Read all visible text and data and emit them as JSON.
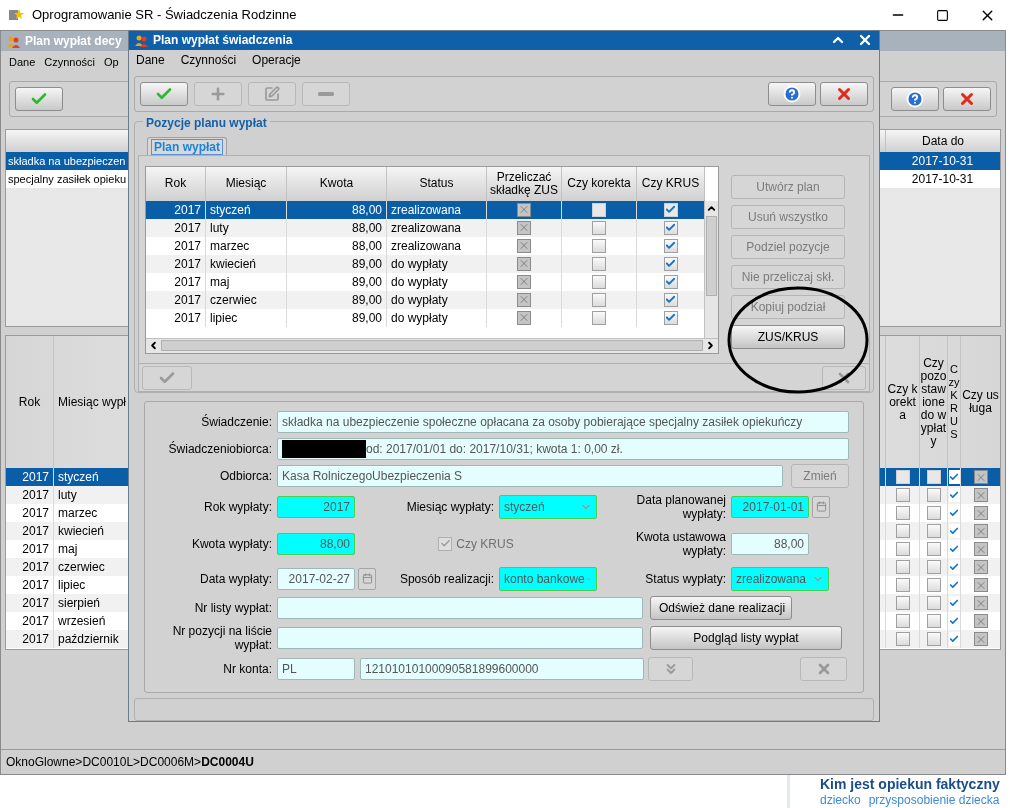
{
  "app_window": {
    "title": "Oprogramowanie SR - Świadczenia Rodzinne"
  },
  "background_window": {
    "title": "Plan wypłat decy",
    "menu": [
      "Dane",
      "Czynności",
      "Op"
    ],
    "toolbar": {
      "left": [
        {
          "kind": "confirm",
          "disabled": false
        }
      ],
      "right": [
        {
          "kind": "help",
          "disabled": false
        },
        {
          "kind": "cancel",
          "disabled": false
        }
      ]
    },
    "upper_table": {
      "columns": [
        "Data do"
      ],
      "rows": [
        {
          "column_1": "składka na ubezpieczen",
          "data_do": "2017-10-31",
          "selected": true
        },
        {
          "column_1": "specjalny zasiłek opieku",
          "data_do": "2017-10-31",
          "selected": false
        }
      ]
    },
    "lower_table": {
      "columns": [
        "Rok",
        "Miesiąc wypł",
        "Czy korekta",
        "Czy pozostawione do wypłaty",
        "Czy KRUS",
        "Czy usługa"
      ],
      "rows": [
        {
          "rok": "2017",
          "miesiac": "styczeń",
          "korekta": false,
          "pozostawione": false,
          "krus": true,
          "usluga_locked": true,
          "selected": true
        },
        {
          "rok": "2017",
          "miesiac": "luty",
          "korekta": false,
          "pozostawione": false,
          "krus": true,
          "usluga_locked": true,
          "selected": false
        },
        {
          "rok": "2017",
          "miesiac": "marzec",
          "korekta": false,
          "pozostawione": false,
          "krus": true,
          "usluga_locked": true,
          "selected": false
        },
        {
          "rok": "2017",
          "miesiac": "kwiecień",
          "korekta": false,
          "pozostawione": false,
          "krus": true,
          "usluga_locked": true,
          "selected": false
        },
        {
          "rok": "2017",
          "miesiac": "maj",
          "korekta": false,
          "pozostawione": false,
          "krus": true,
          "usluga_locked": true,
          "selected": false
        },
        {
          "rok": "2017",
          "miesiac": "czerwiec",
          "korekta": false,
          "pozostawione": false,
          "krus": true,
          "usluga_locked": true,
          "selected": false
        },
        {
          "rok": "2017",
          "miesiac": "lipiec",
          "korekta": false,
          "pozostawione": false,
          "krus": true,
          "usluga_locked": true,
          "selected": false
        },
        {
          "rok": "2017",
          "miesiac": "sierpień",
          "korekta": false,
          "pozostawione": false,
          "krus": true,
          "usluga_locked": true,
          "selected": false
        },
        {
          "rok": "2017",
          "miesiac": "wrzesień",
          "korekta": false,
          "pozostawione": false,
          "krus": true,
          "usluga_locked": true,
          "selected": false
        },
        {
          "rok": "2017",
          "miesiac": "październik",
          "korekta": false,
          "pozostawione": false,
          "krus": true,
          "usluga_locked": true,
          "selected": false
        }
      ]
    },
    "status_bar": "OknoGlowne>DC0010L>DC0006M>**DC0004U**"
  },
  "dialog": {
    "title": "Plan wypłat świadczenia",
    "menu": [
      "Dane",
      "Czynności",
      "Operacje"
    ],
    "toolbar": {
      "left": [
        {
          "kind": "confirm",
          "disabled": false
        },
        {
          "kind": "add",
          "disabled": true
        },
        {
          "kind": "edit",
          "disabled": true
        },
        {
          "kind": "remove",
          "disabled": true
        }
      ],
      "right": [
        {
          "kind": "help",
          "disabled": false
        },
        {
          "kind": "cancel",
          "disabled": false
        }
      ]
    },
    "group_title": "Pozycje planu wypłat",
    "tabs": [
      {
        "label": "Plan wypłat",
        "selected": true
      }
    ],
    "table": {
      "columns": [
        "Rok",
        "Miesiąc",
        "Kwota",
        "Status",
        "Przeliczać składkę ZUS",
        "Czy korekta",
        "Czy KRUS"
      ],
      "rows": [
        {
          "rok": "2017",
          "miesiac": "styczeń",
          "kwota": "88,00",
          "status": "zrealizowana",
          "zus_locked": true,
          "korekta": false,
          "krus": true,
          "selected": true
        },
        {
          "rok": "2017",
          "miesiac": "luty",
          "kwota": "88,00",
          "status": "zrealizowana",
          "zus_locked": true,
          "korekta": false,
          "krus": true,
          "selected": false
        },
        {
          "rok": "2017",
          "miesiac": "marzec",
          "kwota": "88,00",
          "status": "zrealizowana",
          "zus_locked": true,
          "korekta": false,
          "krus": true,
          "selected": false
        },
        {
          "rok": "2017",
          "miesiac": "kwiecień",
          "kwota": "89,00",
          "status": "do wypłaty",
          "zus_locked": true,
          "korekta": false,
          "krus": true,
          "selected": false
        },
        {
          "rok": "2017",
          "miesiac": "maj",
          "kwota": "89,00",
          "status": "do wypłaty",
          "zus_locked": true,
          "korekta": false,
          "krus": true,
          "selected": false
        },
        {
          "rok": "2017",
          "miesiac": "czerwiec",
          "kwota": "89,00",
          "status": "do wypłaty",
          "zus_locked": true,
          "korekta": false,
          "krus": true,
          "selected": false
        },
        {
          "rok": "2017",
          "miesiac": "lipiec",
          "kwota": "89,00",
          "status": "do wypłaty",
          "zus_locked": true,
          "korekta": false,
          "krus": true,
          "selected": false
        }
      ]
    },
    "side_buttons": [
      {
        "label": "Utwórz plan",
        "disabled": true
      },
      {
        "label": "Usuń wszystko",
        "disabled": true
      },
      {
        "label": "Podziel pozycje",
        "disabled": true
      },
      {
        "label": "Nie przeliczaj skł.",
        "disabled": true
      },
      {
        "label": "Kopiuj podział",
        "disabled": true
      },
      {
        "label": "ZUS/KRUS",
        "disabled": false
      }
    ],
    "table_actions": [
      {
        "kind": "confirm",
        "disabled": true
      },
      {
        "kind": "clear",
        "disabled": true
      }
    ],
    "form": {
      "benefit": {
        "label": "Świadczenie:",
        "value": "składka na ubezpieczenie społeczne opłacana za osoby pobierające specjalny zasiłek opiekuńczy"
      },
      "beneficiary": {
        "label": "Świadczeniobiorca:",
        "redacted": true,
        "value": "od: 2017/01/01 do: 2017/10/31; kwota 1: 0,00 zł."
      },
      "recipient": {
        "label": "Odbiorca:",
        "value": "Kasa RolniczegoUbezpieczenia S",
        "button": {
          "label": "Zmień",
          "disabled": true
        }
      },
      "year": {
        "label": "Rok wypłaty:",
        "value": "2017",
        "required": true
      },
      "month": {
        "label": "Miesiąc wypłaty:",
        "value": "styczeń",
        "required": true
      },
      "planned_date": {
        "label": "Data planowanej wypłaty:",
        "value": "2017-01-01",
        "required": true
      },
      "amount": {
        "label": "Kwota wypłaty:",
        "value": "88,00",
        "required": true
      },
      "krus": {
        "label": "Czy KRUS",
        "checked": true,
        "disabled": true
      },
      "statutory_amount": {
        "label": "Kwota ustawowa wypłaty:",
        "value": "88,00",
        "required": false
      },
      "payment_date": {
        "label": "Data wypłaty:",
        "value": "2017-02-27",
        "required": false
      },
      "method": {
        "label": "Sposób realizacji:",
        "value": "konto bankowe",
        "required": true
      },
      "status": {
        "label": "Status wypłaty:",
        "value": "zrealizowana",
        "required": true
      },
      "list_no": {
        "label": "Nr listy wypłat:",
        "button": {
          "label": "Odśwież dane realizacji",
          "disabled": false
        }
      },
      "position_no": {
        "label": "Nr pozycji na liście wypłat:",
        "button": {
          "label": "Podgląd listy wypłat",
          "disabled": false
        }
      },
      "account": {
        "label": "Nr konta:",
        "country": "PL",
        "number": "12101010100090581899600000"
      },
      "account_buttons": [
        {
          "kind": "expand",
          "disabled": true
        },
        {
          "kind": "clear",
          "disabled": true
        }
      ]
    }
  },
  "web_page": {
    "heading": "Kim jest opiekun faktyczny",
    "tags": [
      "dziecko",
      "przysposobienie dziecka"
    ]
  }
}
